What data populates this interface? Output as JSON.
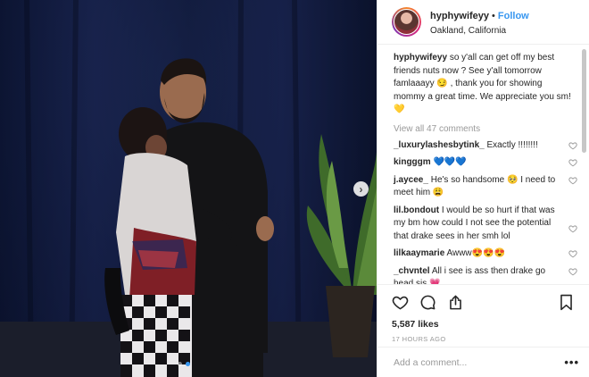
{
  "header": {
    "username": "hyphywifeyy",
    "separator": "•",
    "follow_label": "Follow",
    "location": "Oakland, California"
  },
  "caption": {
    "username": "hyphywifeyy",
    "text": "so y'all can get off my best friends nuts now ? See y'all tomorrow famlaaayy 😏 , thank you for showing mommy a great time. We appreciate you sm! 💛"
  },
  "view_all_label": "View all 47 comments",
  "comments": [
    {
      "username": "_luxurylashesbytink_",
      "text": "Exactly !!!!!!!!"
    },
    {
      "username": "kingggm",
      "text": "💙💙💙"
    },
    {
      "username": "j.aycee_",
      "text": "He's so handsome 🥺 I need to meet him 😩"
    },
    {
      "username": "lil.bondout",
      "text": "I would be so hurt if that was my bm how could I not see the potential that drake sees in her smh lol"
    },
    {
      "username": "lilkaaymarie",
      "text": "Awww😍😍😍"
    },
    {
      "username": "_chvntel",
      "text": "All i see is ass then drake go head sis 💗"
    }
  ],
  "likes": "5,587 likes",
  "timestamp": "17 HOURS AGO",
  "add_comment": {
    "placeholder": "Add a comment...",
    "more_label": "•••"
  },
  "photo": {
    "next_label": "›",
    "slides": 2,
    "active_slide": 1
  },
  "colors": {
    "link": "#3897f0",
    "muted": "#999999",
    "text": "#262626",
    "background": "#000e2e"
  },
  "icons": [
    "like-heart-icon",
    "comment-bubble-icon",
    "share-icon",
    "bookmark-icon",
    "small-heart-icon"
  ]
}
